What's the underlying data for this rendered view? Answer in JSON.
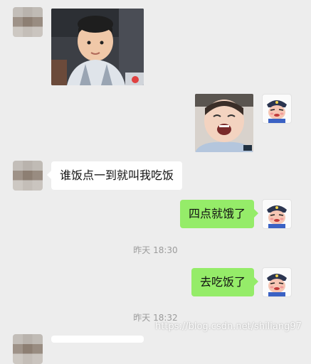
{
  "messages": [
    {
      "id": "m1",
      "from": "other",
      "type": "image",
      "image_desc": "child-photo"
    },
    {
      "id": "m2",
      "from": "me",
      "type": "image",
      "image_desc": "crying-baby-photo"
    },
    {
      "id": "m3",
      "from": "other",
      "type": "text",
      "text": "谁饭点一到就叫我吃饭"
    },
    {
      "id": "m4",
      "from": "me",
      "type": "text",
      "text": "四点就饿了"
    },
    {
      "id": "m5",
      "from": "me",
      "type": "text",
      "text": "去吃饭了"
    }
  ],
  "timestamps": [
    "昨天 18:30",
    "昨天 18:32"
  ],
  "watermark": "https://blog.csdn.net/shiliang97",
  "colors": {
    "background": "#ededed",
    "outgoing_bubble": "#95ec69",
    "incoming_bubble": "#ffffff",
    "timestamp_text": "#9b9b9b"
  },
  "icons": {
    "other_avatar": "blurred-avatar",
    "my_avatar": "cartoon-police-avatar"
  }
}
